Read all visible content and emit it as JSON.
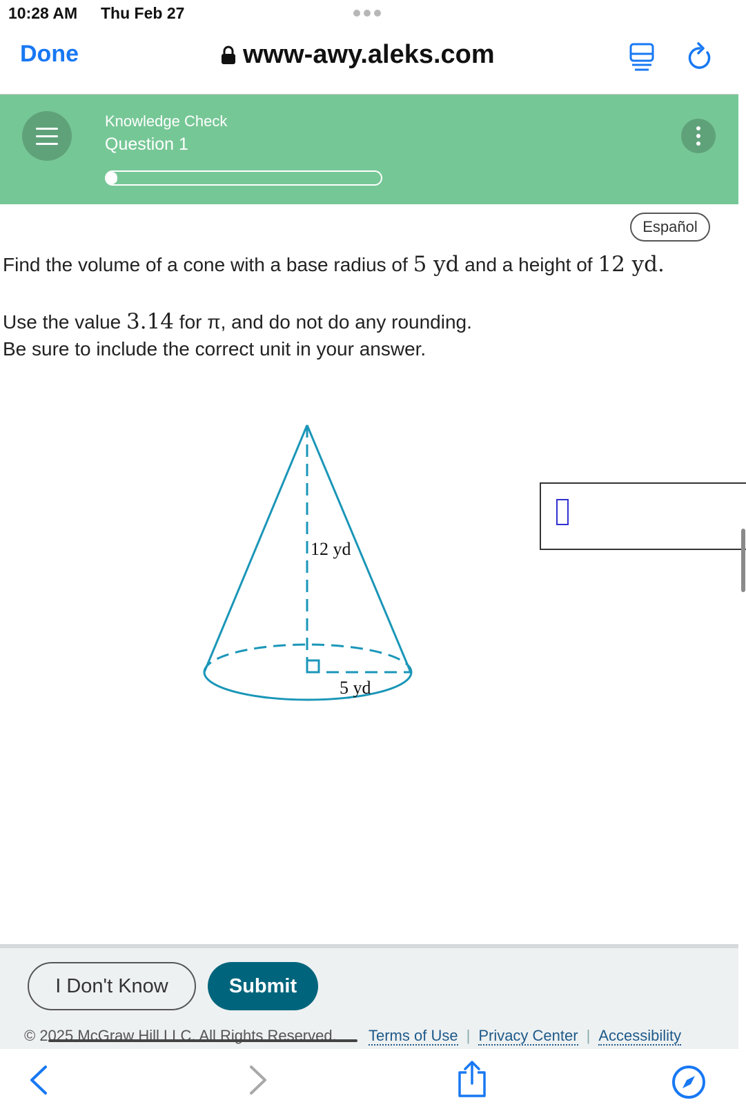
{
  "status_bar": {
    "time": "10:28 AM",
    "date": "Thu Feb 27"
  },
  "browser": {
    "done_label": "Done",
    "url": "www-awy.aleks.com"
  },
  "header": {
    "section": "Knowledge Check",
    "question": "Question 1",
    "progress": 0.04
  },
  "content": {
    "espanol_label": "Español",
    "problem": {
      "p1": "Find the volume of a cone with a base radius of ",
      "radius": "5",
      "unit_r": " yd",
      "p2": " and a height of ",
      "height": "12",
      "unit_h": " yd."
    },
    "instructions": {
      "p1": "Use the value ",
      "pi_value": "3.14",
      "p2": " for π, and do not do any rounding.",
      "line2": "Be sure to include the correct unit in your answer."
    },
    "figure": {
      "height_label": "12 yd",
      "radius_label": "5 yd"
    },
    "answer": {
      "value": ""
    }
  },
  "footer": {
    "dont_know_label": "I Don't Know",
    "submit_label": "Submit",
    "copyright": "© 2025 McGraw Hill LLC. All Rights Reserved.",
    "terms": "Terms of Use",
    "privacy": "Privacy Center",
    "accessibility": "Accessibility"
  },
  "colors": {
    "header_green": "#76c796",
    "submit_teal": "#00657c",
    "link_blue": "#1878f3",
    "cone_teal": "#1a96b8"
  },
  "icons": [
    "lock-icon",
    "reader-icon",
    "reload-icon",
    "menu-icon",
    "more-icon",
    "back-icon",
    "forward-icon",
    "share-icon",
    "compass-icon"
  ]
}
